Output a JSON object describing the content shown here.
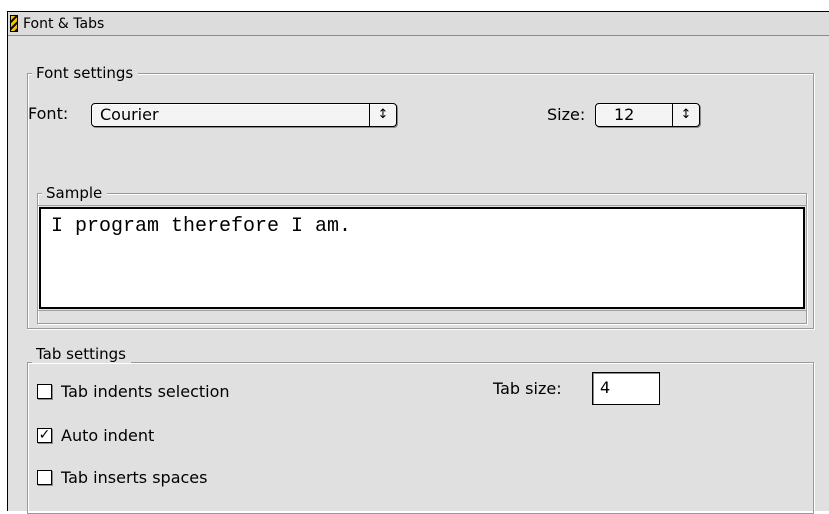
{
  "window": {
    "title": "Font & Tabs"
  },
  "font_settings": {
    "group_label": "Font settings",
    "font_label": "Font:",
    "font_value": "Courier",
    "size_label": "Size:",
    "size_value": "12",
    "popup_arrow": "↕"
  },
  "sample": {
    "group_label": "Sample",
    "text": "I program therefore I am."
  },
  "tab_settings": {
    "group_label": "Tab settings",
    "tab_indents_selection": {
      "label": "Tab indents selection",
      "checked": false
    },
    "auto_indent": {
      "label": "Auto indent",
      "checked": true,
      "mark": "✓"
    },
    "tab_inserts_spaces": {
      "label": "Tab inserts spaces",
      "checked": false
    },
    "tab_size_label": "Tab size:",
    "tab_size_value": "4"
  }
}
